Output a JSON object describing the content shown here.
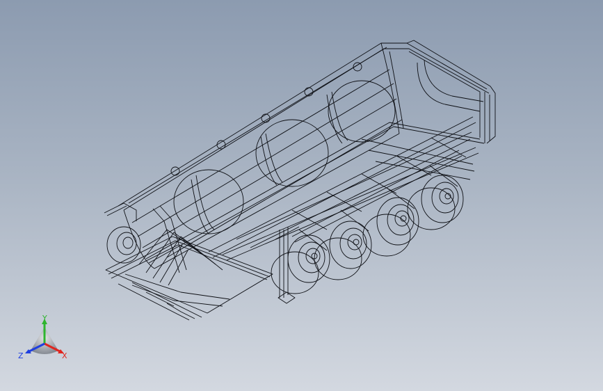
{
  "viewport": {
    "background_top": "#8c9bb0",
    "background_bottom": "#d3d8e0",
    "render_mode": "wireframe",
    "model_subject": "tipper-semi-trailer",
    "line_color": "#0d0f14"
  },
  "triad": {
    "x_label": "X",
    "y_label": "Y",
    "z_label": "Z",
    "x_color": "#e0261f",
    "y_color": "#2fb52f",
    "z_color": "#1f3fe0"
  }
}
